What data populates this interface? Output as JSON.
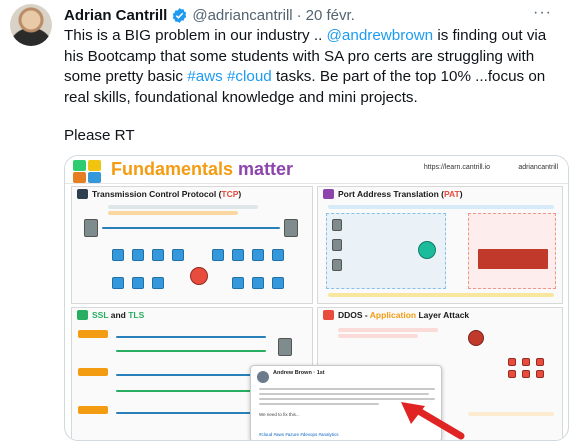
{
  "tweet": {
    "author_name": "Adrian Cantrill",
    "handle": "@adriancantrill",
    "separator": "·",
    "date": "20 févr.",
    "more_label": "···",
    "text_part1": "This is a BIG problem in our industry .. ",
    "mention": "@andrewbrown",
    "text_part2": " is finding out via his Bootcamp that some students with SA pro certs are struggling with some pretty basic ",
    "hashtag_aws": "#aws",
    "text_part3": " ",
    "hashtag_cloud": "#cloud",
    "text_part4": " tasks. Be part of the top 10% ...focus on real skills, foundational knowledge and mini projects.",
    "text_rt": "Please RT"
  },
  "media": {
    "title_word1": "Fundamentals",
    "title_word2": "matter",
    "link_text": "https://learn.cantrill.io",
    "handle_text": "adriancantrill",
    "panels": {
      "tcp": {
        "title_prefix": "Transmission Control Protocol (",
        "title_hl": "TCP",
        "title_suffix": ")"
      },
      "pat": {
        "title_prefix": "Port Address Translation (",
        "title_hl": "PAT",
        "title_suffix": ")"
      },
      "ssl": {
        "title_prefix": "SSL",
        "title_mid": " and ",
        "title_suffix": "TLS"
      },
      "ddos": {
        "title_prefix": "DDOS - ",
        "title_hl": "Application",
        "title_suffix": " Layer Attack"
      }
    },
    "overlay": {
      "name": "Andrew Brown · 1st",
      "snippet": "We need to fix this...",
      "tags": "#cloud #aws #azure #devops #analytics"
    }
  },
  "colors": {
    "link": "#1d9bf0",
    "verified": "#1d9bf0",
    "title_orange": "#f39c12",
    "title_purple": "#8e44ad"
  }
}
